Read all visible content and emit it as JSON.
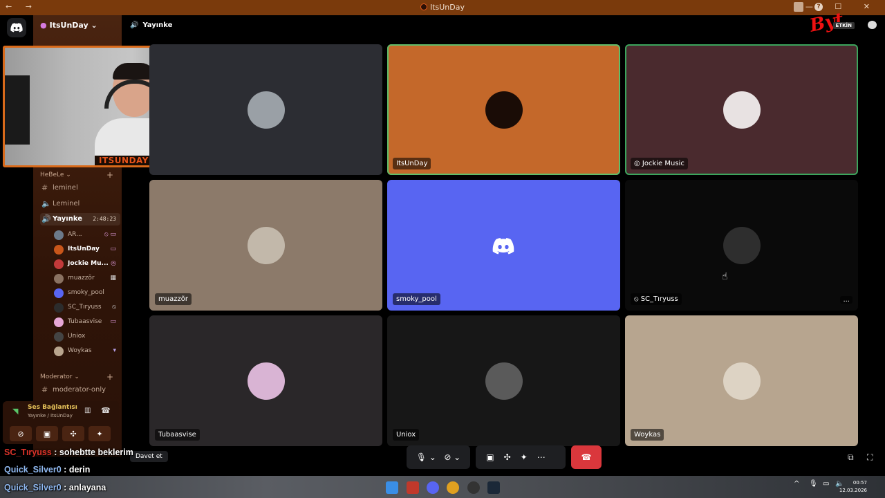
{
  "window": {
    "title": "ItsUnDay"
  },
  "topbar": {
    "channel": "Yayınke",
    "etkin": "ETKİN",
    "logo": "Byt"
  },
  "server": {
    "name": "ItsUnDay"
  },
  "sidebar": {
    "categories": [
      {
        "label": "HeBeLe ⌄"
      },
      {
        "label": "Moderator ⌄"
      }
    ],
    "channels": [
      {
        "label": "leminel",
        "type": "text"
      },
      {
        "label": "Leminel",
        "type": "voice"
      },
      {
        "label": "Yayınke",
        "type": "voice",
        "timer": "2:48:23"
      },
      {
        "label": "moderator-only",
        "type": "text"
      }
    ],
    "members": [
      {
        "name": "AR...",
        "color": "#6c7a8a"
      },
      {
        "name": "ItsUnDay",
        "color": "#c9561a"
      },
      {
        "name": "Jockie Mu...",
        "color": "#c23a3a"
      },
      {
        "name": "muazzõr",
        "color": "#8a7262"
      },
      {
        "name": "smoky_pool",
        "color": "#5865f2"
      },
      {
        "name": "SC_Tıryuss",
        "color": "#2c2c2c"
      },
      {
        "name": "Tubaasvise",
        "color": "#e7a7d6"
      },
      {
        "name": "Uniox",
        "color": "#444"
      },
      {
        "name": "Woykas",
        "color": "#b9a58e"
      }
    ]
  },
  "voice_panel": {
    "status": "Ses Bağlantısı K",
    "sub": "Yayınke / ItsUnDay"
  },
  "webcam": {
    "label": "ITSUNDAY"
  },
  "chat": [
    {
      "user": "SC_Tıryuss",
      "sep": " : ",
      "msg": "sohebtte beklerim"
    },
    {
      "user": "Quick_Silver0",
      "sep": " : ",
      "msg": "derin"
    },
    {
      "user": "Quick_Silver0",
      "sep": " : ",
      "msg": "anlayana"
    }
  ],
  "tiles": [
    {
      "name": "",
      "bg": "#2c2d33",
      "avatar": "#9aa0a6"
    },
    {
      "name": "ItsUnDay",
      "bg": "#c4682a",
      "avatar": "#1a0c06"
    },
    {
      "name": "Jockie Music",
      "bg": "#4a2a2e",
      "avatar": "#e8e2e2"
    },
    {
      "name": "muazzõr",
      "bg": "#8c7a6a",
      "avatar": "#c2b8aa"
    },
    {
      "name": "smoky_pool",
      "bg": "#5865f2",
      "avatar": "#5865f2"
    },
    {
      "name": "SC_Tıryuss",
      "bg": "#0a0a0a",
      "avatar": "#2e2e2e"
    },
    {
      "name": "Tubaasvise",
      "bg": "#2a2729",
      "avatar": "#d9b4d4"
    },
    {
      "name": "Uniox",
      "bg": "#171717",
      "avatar": "#5a5a5a"
    },
    {
      "name": "Woykas",
      "bg": "#b7a58f",
      "avatar": "#ddd3c4"
    }
  ],
  "tile_more": "...",
  "controls": {
    "invite": "Davet et"
  },
  "taskbar": {
    "time": "00:57",
    "date": "12.03.2026"
  }
}
